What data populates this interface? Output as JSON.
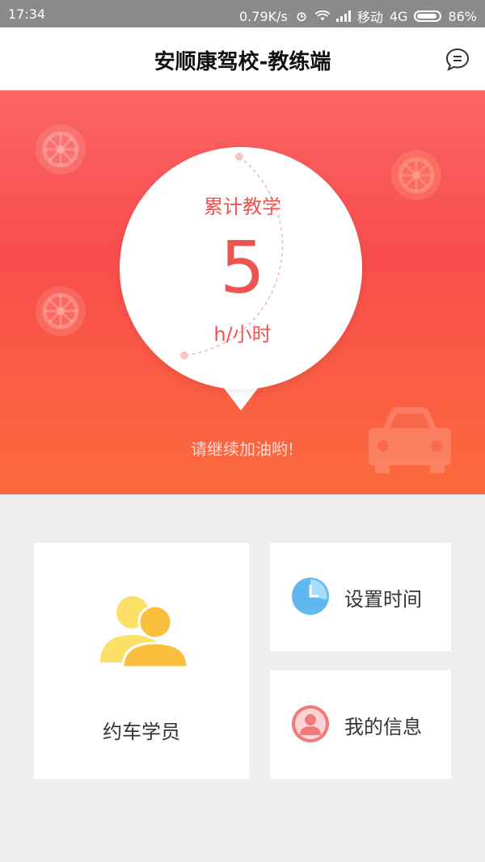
{
  "status_bar": {
    "time": "17:34",
    "net_speed": "0.79K/s",
    "carrier": "移动",
    "network": "4G",
    "battery": "86%"
  },
  "header": {
    "title": "安顺康驾校-教练端",
    "message_icon": "chat-bubble-icon"
  },
  "hero": {
    "label": "累计教学",
    "hours": "5",
    "unit": "h/小时",
    "encouragement": "请继续加油哟!",
    "gradient_top": "#fb6565",
    "gradient_bottom": "#fb6a3c",
    "accent": "#f0534f"
  },
  "menu": {
    "students_label": "约车学员",
    "students_icon": "people-icon",
    "set_time_label": "设置时间",
    "set_time_icon": "clock-icon",
    "my_info_label": "我的信息",
    "my_info_icon": "user-icon"
  }
}
